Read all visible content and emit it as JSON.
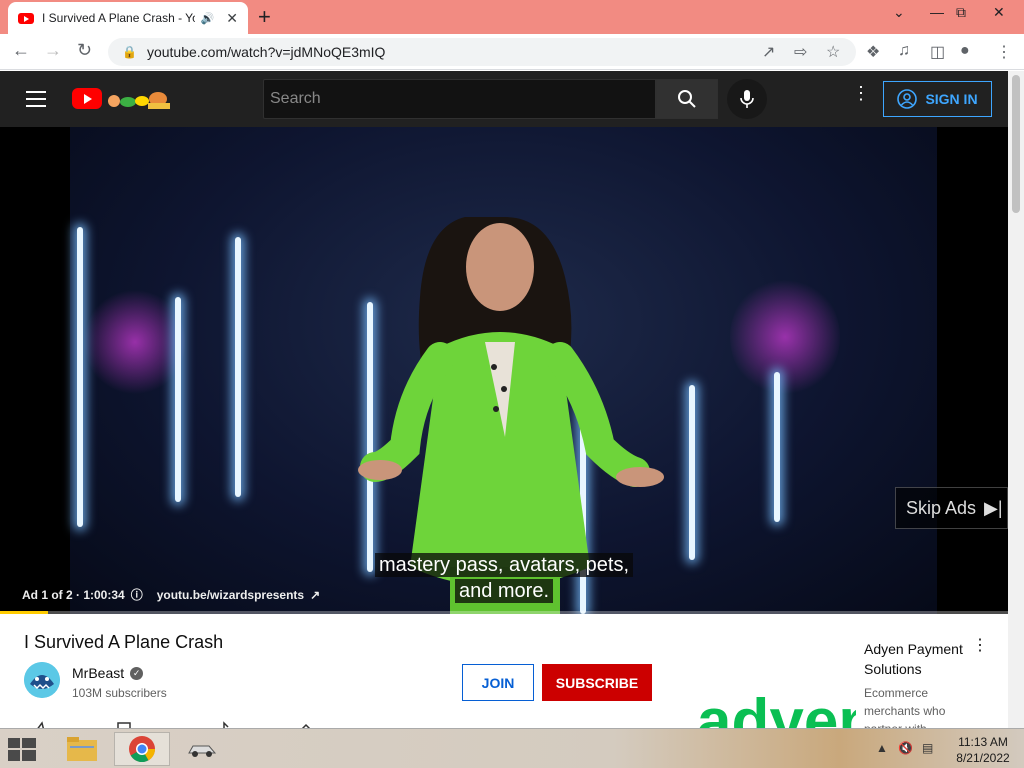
{
  "browser": {
    "tab_title": "I Survived A Plane Crash - YouTube",
    "url": "youtube.com/watch?v=jdMNoQE3mIQ"
  },
  "masthead": {
    "search_placeholder": "Search",
    "sign_in_label": "SIGN IN"
  },
  "player": {
    "skip_label": "Skip Ads",
    "caption_line1": "mastery pass, avatars, pets,",
    "caption_line2": "and more.",
    "ad_counter": "Ad 1 of 2 · 1:00:34",
    "ad_link": "youtu.be/wizardspresents",
    "progress_fraction": 0.048
  },
  "video": {
    "title": "I Survived A Plane Crash",
    "channel_name": "MrBeast",
    "subscribers": "103M subscribers",
    "join_label": "JOIN",
    "subscribe_label": "SUBSCRIBE"
  },
  "sidebar_ad": {
    "title": "Adyen Payment Solutions",
    "description": "Ecommerce merchants who partner with",
    "logo_text": "adyen",
    "logo_color": "#0abf53"
  },
  "taskbar": {
    "time": "11:13 AM",
    "date": "8/21/2022"
  },
  "colors": {
    "tab_strip": "#f28b82",
    "yt_red": "#ff0000",
    "subscribe_red": "#cc0000",
    "signin_blue": "#3ea6ff",
    "progress_yellow": "#ffcc00",
    "blazer_green": "#6ed43a"
  }
}
